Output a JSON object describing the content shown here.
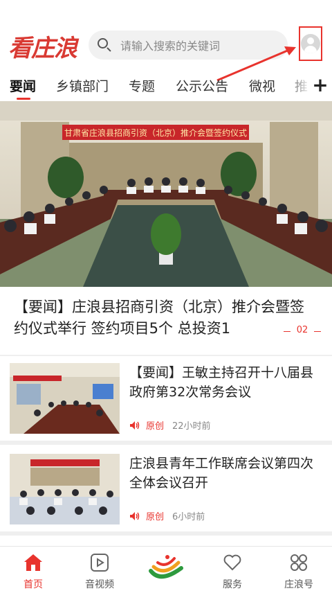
{
  "header": {
    "logo": "看庄浪",
    "search_placeholder": "请输入搜索的关键词"
  },
  "tabs": [
    {
      "label": "要闻",
      "active": true
    },
    {
      "label": "乡镇部门",
      "active": false
    },
    {
      "label": "专题",
      "active": false
    },
    {
      "label": "公示公告",
      "active": false
    },
    {
      "label": "微视",
      "active": false
    },
    {
      "label": "推",
      "active": false
    }
  ],
  "tabs_more": "+",
  "banner": {
    "sign_text": "甘肃省庄浪县招商引资（北京）推介会暨签约仪式",
    "title": "【要闻】庄浪县招商引资（北京）推介会暨签约仪式举行 签约项目5个 总投资1",
    "page": "02"
  },
  "news": [
    {
      "title": "【要闻】王敏主持召开十八届县政府第32次常务会议",
      "source": "原创",
      "time": "22小时前",
      "thumb_sign": ""
    },
    {
      "title": "庄浪县青年工作联席会议第四次全体会议召开",
      "source": "原创",
      "time": "6小时前",
      "thumb_sign": ""
    }
  ],
  "peek_title": "",
  "bottom_nav": [
    {
      "label": "首页",
      "icon": "home-icon",
      "active": true
    },
    {
      "label": "音视频",
      "icon": "play-icon",
      "active": false
    },
    {
      "label": "",
      "icon": "center-logo",
      "active": false
    },
    {
      "label": "服务",
      "icon": "heart-icon",
      "active": false
    },
    {
      "label": "庄浪号",
      "icon": "grid-icon",
      "active": false
    }
  ],
  "colors": {
    "accent": "#e8332d",
    "banner_sign": "#c8262a"
  }
}
